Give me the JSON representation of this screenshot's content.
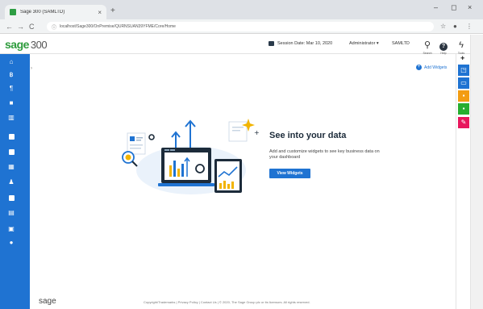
{
  "browser": {
    "tab_title": "Sage 300 (SAMLTD)",
    "tab_close": "×",
    "new_tab": "+",
    "window_controls": {
      "minimize": "–",
      "maximize": "◻",
      "close": "×"
    },
    "nav": {
      "back": "←",
      "forward": "→",
      "reload": "C"
    },
    "address": "localhost/Sage300/OnPremise/QURNSUAN39YFME/Core/Home",
    "star": "☆",
    "menu": "⋮"
  },
  "header": {
    "logo_text": "sage",
    "logo_number": "300",
    "session_label": "Session Date: Mar 10, 2020",
    "user": "Administrator ▾",
    "company": "SAMLTD",
    "search_label": "Search",
    "help_label": "Help",
    "tools_label": "Tools"
  },
  "sidebar": {
    "items": [
      {
        "icon": "home-icon"
      },
      {
        "icon": "bank-icon"
      },
      {
        "icon": "ledger-icon"
      },
      {
        "icon": "lock-icon"
      },
      {
        "icon": "building-icon"
      },
      {
        "icon": "briefcase-icon"
      },
      {
        "icon": "truck-icon"
      },
      {
        "icon": "grid-icon"
      },
      {
        "icon": "person-icon"
      },
      {
        "icon": "clipboard-icon"
      },
      {
        "icon": "document-icon"
      },
      {
        "icon": "box-icon"
      },
      {
        "icon": "settings-icon"
      }
    ]
  },
  "rail": {
    "pin": "✚",
    "buttons": [
      {
        "icon": "window-icon",
        "color": "#1f73d2"
      },
      {
        "icon": "screen-icon",
        "color": "#1f73d2"
      },
      {
        "icon": "note-icon",
        "color": "#f39c12"
      },
      {
        "icon": "file-icon",
        "color": "#27ae30"
      },
      {
        "icon": "pen-icon",
        "color": "#e8175d"
      }
    ]
  },
  "content": {
    "add_widgets": "Add Widgets",
    "title": "See into your data",
    "description": "Add and customize widgets to see key business data on your dashboard",
    "button": "View Widgets"
  },
  "footer": {
    "logo": "sage",
    "links": "Copyright/Trademarks  |  Privacy Policy  |  Contact Us  |  © 2020, The Sage Group plc or its licensors. All rights reserved."
  },
  "colors": {
    "brand_blue": "#1f73d2",
    "sage_green": "#2d9b3c"
  }
}
